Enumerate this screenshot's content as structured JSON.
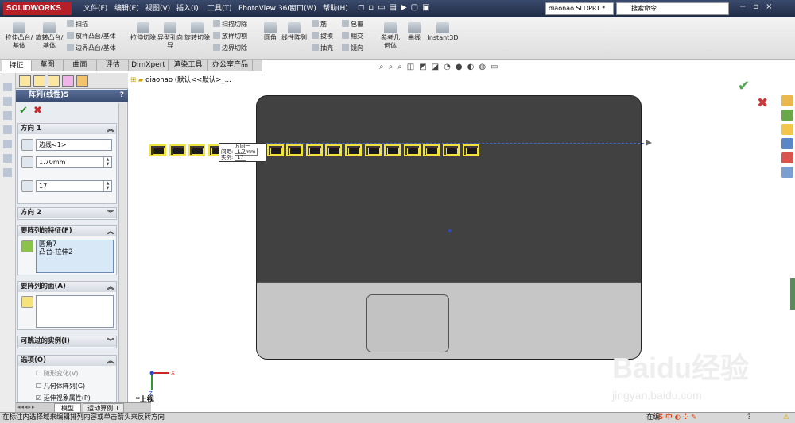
{
  "app": {
    "logo": "SOLIDWORKS",
    "menus": [
      "文件(F)",
      "编辑(E)",
      "视图(V)",
      "插入(I)",
      "工具(T)",
      "PhotoView 360",
      "窗口(W)",
      "帮助(H)"
    ],
    "file_name": "diaonao.SLDPRT *",
    "search_placeholder": "搜索命令"
  },
  "ribbon": {
    "extrude_boss": "拉伸凸台/基体",
    "revolve_boss": "旋转凸台/基体",
    "sweep": "扫描",
    "loft_boss": "放样凸台/基体",
    "boundary_boss": "边界凸台/基体",
    "extrude_cut": "拉伸切除",
    "hole_wizard": "异型孔向导",
    "revolve_cut": "旋转切除",
    "swept_cut": "扫描切除",
    "lofted_cut": "放样切割",
    "boundary_cut": "边界切除",
    "fillet": "圆角",
    "linear_pattern": "线性阵列",
    "rib": "筋",
    "draft": "拔模",
    "shell": "抽壳",
    "wrap": "包覆",
    "intersect": "相交",
    "mirror": "镜向",
    "ref_geometry": "参考几何体",
    "curves": "曲线",
    "instant3d": "Instant3D"
  },
  "tabs": [
    "特征",
    "草图",
    "曲面",
    "评估",
    "DimXpert",
    "渲染工具",
    "办公室产品"
  ],
  "property_manager": {
    "title": "阵列(线性)5",
    "help": "?",
    "direction1": {
      "header": "方向 1",
      "edge": "边线<1>",
      "spacing": "1.70mm",
      "instances": "17"
    },
    "direction2": {
      "header": "方向 2"
    },
    "features_to_pattern": {
      "header": "要阵列的特征(F)",
      "items": [
        "圆角7",
        "凸台-拉伸2"
      ]
    },
    "faces_to_pattern": {
      "header": "要阵列的面(A)"
    },
    "instances_to_skip": {
      "header": "可跳过的实例(I)"
    },
    "options": {
      "header": "选项(O)",
      "vary_sketch": "随形变化(V)",
      "geometry_pattern": "几何体阵列(G)",
      "propagate_visual": "延伸视象属性(P)"
    }
  },
  "viewport": {
    "tree_label": "diaonao  (默认<<默认>_...",
    "callout": {
      "title": "方向一",
      "spacing_label": "间距:",
      "spacing_value": "1.7mm",
      "instances_label": "实例:",
      "instances_value": "17"
    },
    "pattern_count": 17,
    "view_name": "*上视"
  },
  "bottom_tabs": [
    "模型",
    "运动算例 1"
  ],
  "status_text": "在标注内选择域来编辑排列内容或单击箭头来反转方向",
  "watermark": "Baidu经验",
  "watermark_sub": "jingyan.baidu.com",
  "status_right": "在编"
}
